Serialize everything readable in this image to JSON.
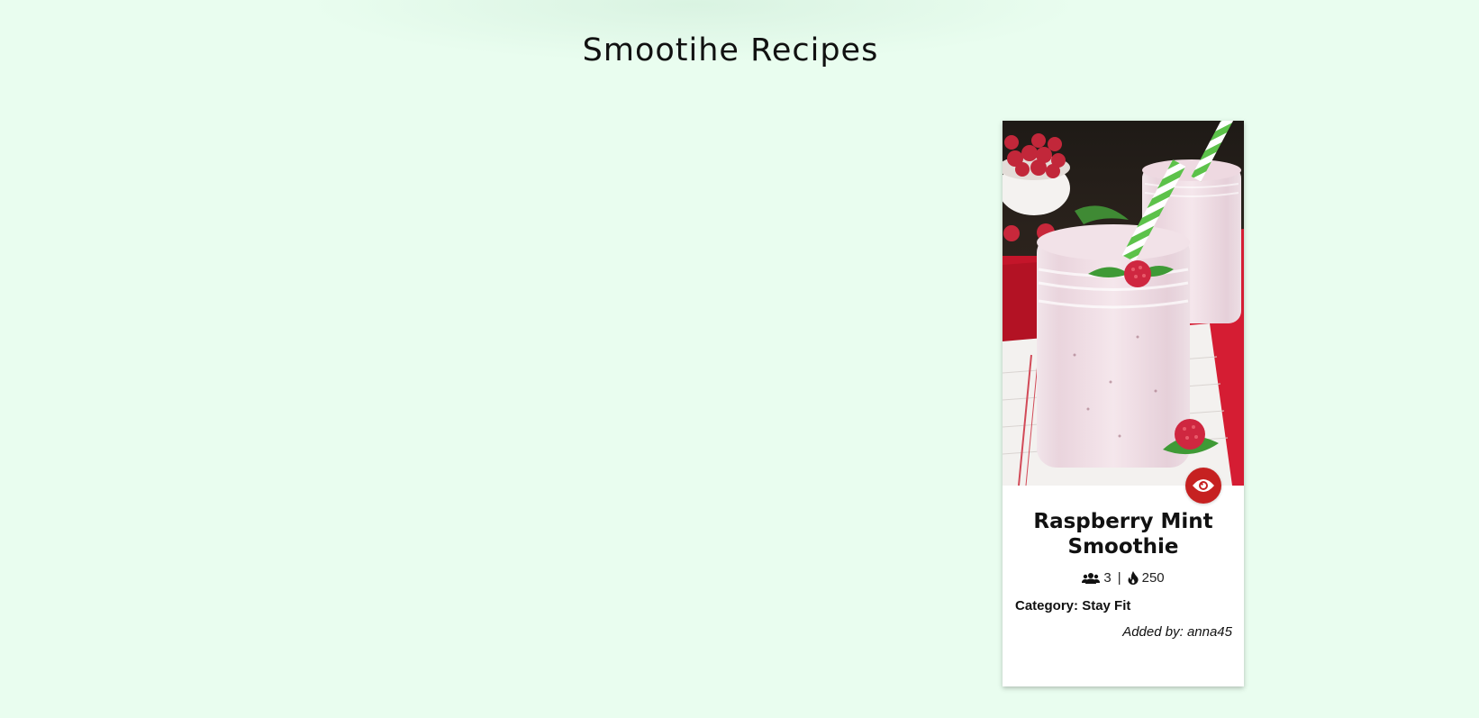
{
  "page": {
    "title": "Smootihe Recipes",
    "background_color": "#e9fdef"
  },
  "recipe_card": {
    "title": "Raspberry Mint Smoothie",
    "servings": "3",
    "separator": "|",
    "calories": "250",
    "category_label": "Category:",
    "category_value": "Stay Fit",
    "added_by_label": "Added by:",
    "added_by_user": "anna45",
    "image_alt": "Raspberry Mint Smoothie",
    "icons": {
      "servings": "users-icon",
      "calories": "fire-icon",
      "view": "eye-icon"
    },
    "accent_color": "#c62121"
  }
}
